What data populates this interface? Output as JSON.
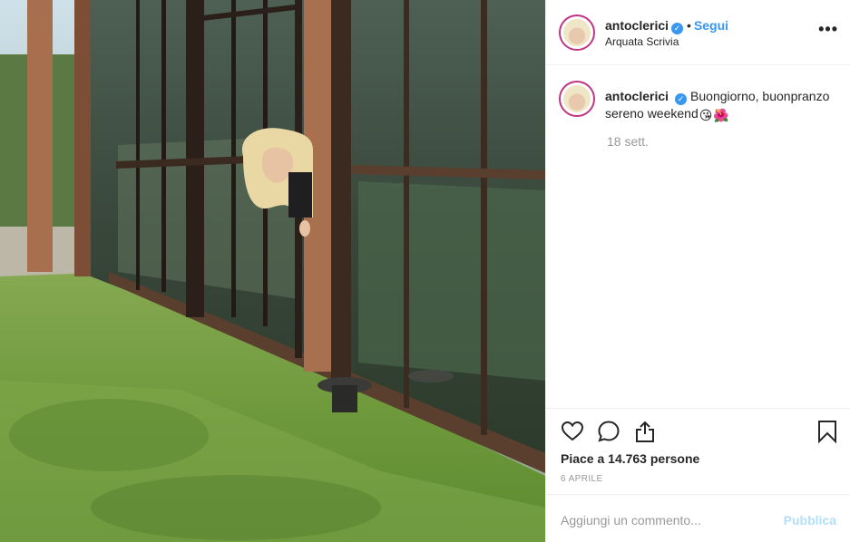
{
  "post": {
    "username": "antoclerici",
    "verified_icon": "verified-badge-icon",
    "follow_label": "Segui",
    "separator": "•",
    "location": "Arquata Scrivia",
    "more_icon": "more-options-icon"
  },
  "caption": {
    "username": "antoclerici",
    "text": "Buongiorno, buonpranzo sereno weekend",
    "emojis": [
      "😘",
      "🌺"
    ],
    "time_ago": "18 sett."
  },
  "actions": {
    "like_icon": "heart-icon",
    "comment_icon": "comment-icon",
    "share_icon": "share-icon",
    "save_icon": "bookmark-icon",
    "likes_text": "Piace a 14.763 persone",
    "date": "6 APRILE"
  },
  "comment_box": {
    "placeholder": "Aggiungi un commento...",
    "publish_label": "Pubblica"
  },
  "colors": {
    "link_blue": "#3897f0",
    "publish_disabled": "#b2dffc",
    "muted_text": "#999999",
    "avatar_ring": "#c13584"
  }
}
